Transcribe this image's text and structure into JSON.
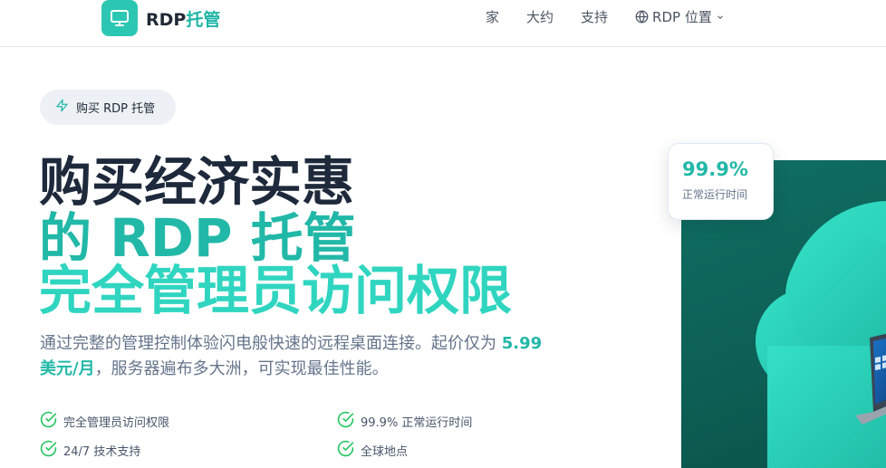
{
  "brand": {
    "name_prefix": "RDP",
    "name_suffix": "托管",
    "icon": "monitor-icon"
  },
  "nav": {
    "items": [
      {
        "label": "家"
      },
      {
        "label": "大约"
      },
      {
        "label": "支持"
      }
    ],
    "language": {
      "label": "RDP 位置",
      "icon": "globe-icon",
      "chevron": "chevron-down-icon"
    }
  },
  "hero": {
    "pill": {
      "label": "购买 RDP 托管",
      "icon": "lightning-icon"
    },
    "title_line1": "购买经济实惠",
    "title_line2": "的 RDP 托管",
    "title_line3": "完全管理员访问权限",
    "description_part1": "通过完整的管理控制体验闪电般快速的远程桌面连接。起价仅为 ",
    "price": "5.99 美元/月",
    "description_part2": "，服务器遍布多大洲，可实现最佳性能。",
    "features": [
      {
        "label": "完全管理员访问权限",
        "icon": "check-circle-icon"
      },
      {
        "label": "99.9% 正常运行时间",
        "icon": "check-circle-icon"
      },
      {
        "label": "24/7 技术支持",
        "icon": "check-circle-icon"
      },
      {
        "label": "全球地点",
        "icon": "check-circle-icon"
      }
    ]
  },
  "uptime_card": {
    "value": "99.9%",
    "label": "正常运行时间"
  },
  "colors": {
    "accent": "#22b8a8",
    "accent_light": "#30d5c0",
    "dark_text": "#1e293b",
    "hero_bg": "#0f6f63"
  }
}
